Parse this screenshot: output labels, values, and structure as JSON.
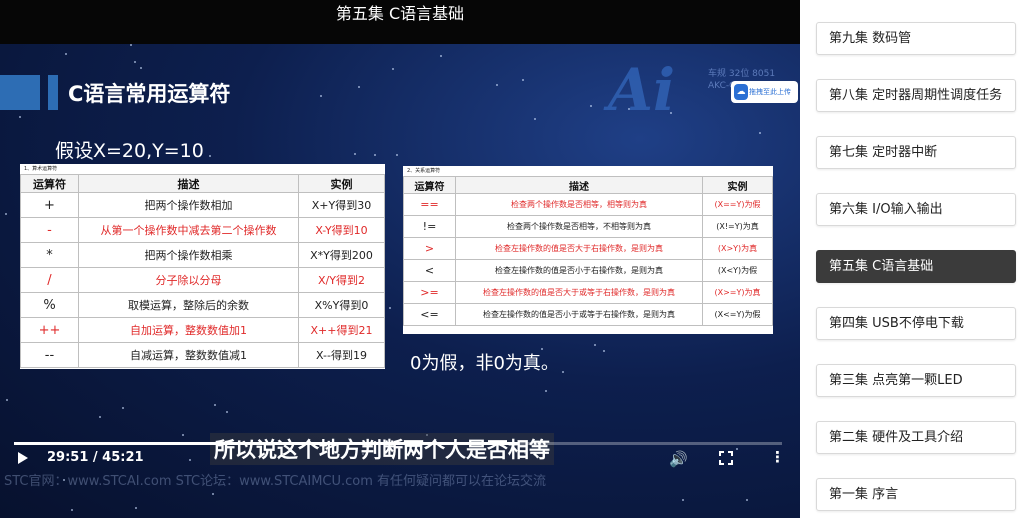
{
  "video": {
    "title": "第五集 C语言基础",
    "slide": {
      "heading": "C语言常用运算符",
      "assumption": "假设X=20,Y=10",
      "logo_text": "Ai",
      "logo_sub_1": "车规 32位 8051",
      "logo_sub_2": "AKC-C",
      "upload_label": "拖拽至此上传",
      "arith_caption": "1、算术运算符",
      "arith_headers": [
        "运算符",
        "描述",
        "实例"
      ],
      "arith_rows": [
        {
          "op": "+",
          "desc": "把两个操作数相加",
          "ex": "X+Y得到30",
          "red": false
        },
        {
          "op": "-",
          "desc": "从第一个操作数中减去第二个操作数",
          "ex": "X-Y得到10",
          "red": true
        },
        {
          "op": "*",
          "desc": "把两个操作数相乘",
          "ex": "X*Y得到200",
          "red": false
        },
        {
          "op": "/",
          "desc": "分子除以分母",
          "ex": "X/Y得到2",
          "red": true
        },
        {
          "op": "%",
          "desc": "取模运算，整除后的余数",
          "ex": "X%Y得到0",
          "red": false
        },
        {
          "op": "++",
          "desc": "自加运算，整数数值加1",
          "ex": "X++得到21",
          "red": true
        },
        {
          "op": "--",
          "desc": "自减运算，整数数值减1",
          "ex": "X--得到19",
          "red": false
        }
      ],
      "rel_caption": "2、关系运算符",
      "rel_headers": [
        "运算符",
        "描述",
        "实例"
      ],
      "rel_rows": [
        {
          "op": "==",
          "desc": "检查两个操作数是否相等，相等则为真",
          "ex": "(X==Y)为假",
          "red": true
        },
        {
          "op": "!=",
          "desc": "检查两个操作数是否相等，不相等则为真",
          "ex": "(X!=Y)为真",
          "red": false
        },
        {
          "op": ">",
          "desc": "检查左操作数的值是否大于右操作数，是则为真",
          "ex": "(X>Y)为真",
          "red": true
        },
        {
          "op": "<",
          "desc": "检查左操作数的值是否小于右操作数，是则为真",
          "ex": "(X<Y)为假",
          "red": false
        },
        {
          "op": ">=",
          "desc": "检查左操作数的值是否大于或等于右操作数，是则为真",
          "ex": "(X>=Y)为真",
          "red": true
        },
        {
          "op": "<=",
          "desc": "检查左操作数的值是否小于或等于右操作数，是则为真",
          "ex": "(X<=Y)为假",
          "red": false
        }
      ],
      "zero_note": "0为假，非0为真。"
    },
    "watermark": "STC官网：www.STCAI.com     STC论坛：www.STCAIMCU.com     有任何疑问都可以在论坛交流",
    "subtitle": "所以说这个地方判断两个人是否相等",
    "time_display": "29:51 / 45:21",
    "progress_fraction": 0.658,
    "icons": [
      "play-icon",
      "volume-icon",
      "fullscreen-icon",
      "more-vert-icon"
    ]
  },
  "sidebar": {
    "active_index": 4,
    "episodes": [
      "第九集 数码管",
      "第八集 定时器周期性调度任务",
      "第七集 定时器中断",
      "第六集 I/O输入输出",
      "第五集 C语言基础",
      "第四集 USB不停电下载",
      "第三集 点亮第一颗LED",
      "第二集 硬件及工具介绍",
      "第一集 序言"
    ]
  },
  "colors": {
    "accent_red": "#e02a2a",
    "slide_blue": "#2d6db4",
    "active_episode": "#3b3b3b"
  }
}
